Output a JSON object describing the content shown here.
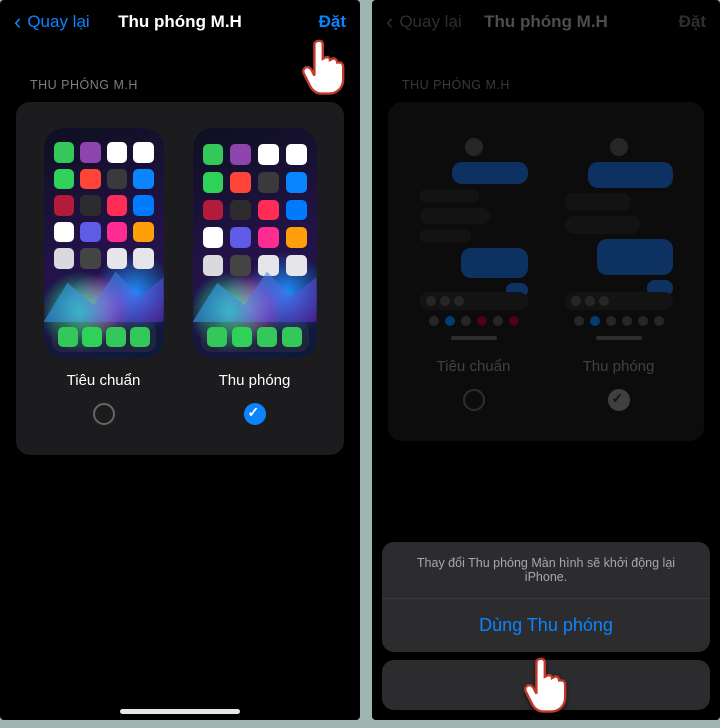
{
  "nav": {
    "back_label": "Quay lại",
    "title": "Thu phóng M.H",
    "set_label": "Đặt"
  },
  "section_header": "THU PHÓNG M.H",
  "options": {
    "standard_label": "Tiêu chuẩn",
    "zoomed_label": "Thu phóng"
  },
  "sheet": {
    "message": "Thay đổi Thu phóng Màn hình sẽ khởi động lại iPhone.",
    "confirm_label": "Dùng Thu phóng"
  }
}
